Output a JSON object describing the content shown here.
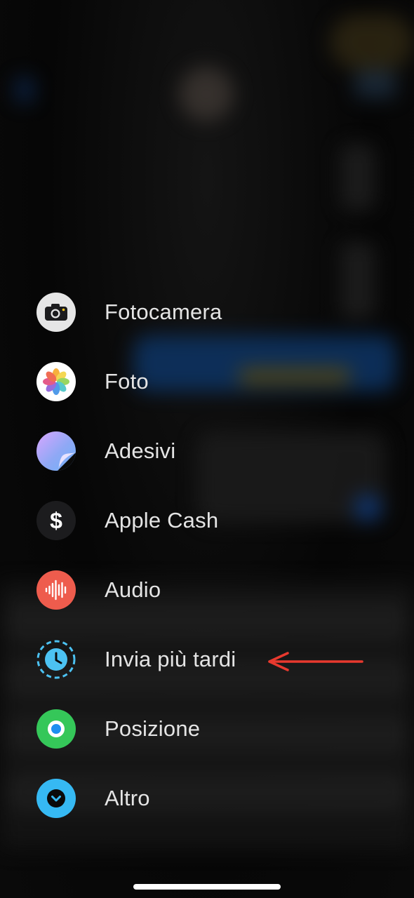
{
  "menu": {
    "items": [
      {
        "label": "Fotocamera",
        "icon": "camera-icon"
      },
      {
        "label": "Foto",
        "icon": "photos-icon"
      },
      {
        "label": "Adesivi",
        "icon": "stickers-icon"
      },
      {
        "label": "Apple Cash",
        "icon": "apple-cash-icon"
      },
      {
        "label": "Audio",
        "icon": "audio-waveform-icon"
      },
      {
        "label": "Invia più tardi",
        "icon": "send-later-clock-icon"
      },
      {
        "label": "Posizione",
        "icon": "location-icon"
      },
      {
        "label": "Altro",
        "icon": "chevron-down-icon"
      }
    ]
  },
  "annotation": {
    "icon": "red-arrow-icon",
    "color": "#e8392e"
  },
  "colors": {
    "label_text": "#e4e4e4",
    "camera_bg": "#e6e6e6",
    "cash_bg": "#1c1c1e",
    "audio_bg": "#ee5c4d",
    "send_later": "#4cc2f2",
    "location_bg": "#35c759",
    "more_bg": "#36b9f3"
  }
}
